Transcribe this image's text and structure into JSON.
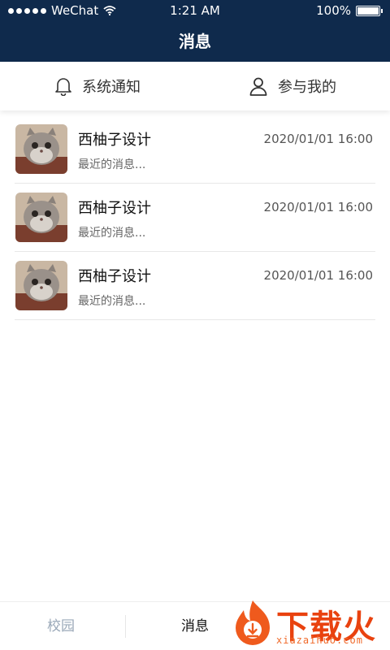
{
  "status_bar": {
    "carrier": "WeChat",
    "time": "1:21 AM",
    "battery": "100%",
    "battery_level": 1.0
  },
  "nav": {
    "title": "消息"
  },
  "tabs": [
    {
      "label": "系统通知",
      "icon": "bell-icon"
    },
    {
      "label": "参与我的",
      "icon": "person-icon"
    }
  ],
  "messages": [
    {
      "name": "西柚子设计",
      "time": "2020/01/01 16:00",
      "preview": "最近的消息..."
    },
    {
      "name": "西柚子设计",
      "time": "2020/01/01 16:00",
      "preview": "最近的消息..."
    },
    {
      "name": "西柚子设计",
      "time": "2020/01/01 16:00",
      "preview": "最近的消息..."
    }
  ],
  "bottom_tabs": [
    {
      "label": "校园",
      "active": false
    },
    {
      "label": "消息",
      "active": true
    }
  ],
  "colors": {
    "header_bg": "#0f2a4c",
    "active_tab": "#111111",
    "inactive_tab": "#9aa8b8",
    "watermark": "#e9420f"
  },
  "watermark": {
    "brand": "下载火",
    "url": "xiazaihuo.com"
  }
}
